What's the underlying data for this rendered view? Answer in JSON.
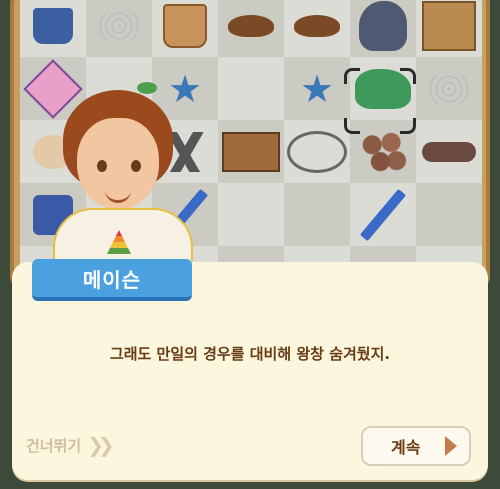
{
  "dialog": {
    "speaker": "메이슨",
    "text": "그래도 만일의 경우를 대비해 왕창 숨겨뒀지."
  },
  "controls": {
    "skip_label": "건너뛰기",
    "skip_icon": "double-chevron-right-icon",
    "continue_label": "계속",
    "continue_icon": "play-triangle-icon"
  },
  "colors": {
    "name_tag": "#4ba0e0",
    "dialog_bg": "#fdf6df",
    "dialog_text": "#6a3c14",
    "skip_text": "#cdbfa0"
  }
}
